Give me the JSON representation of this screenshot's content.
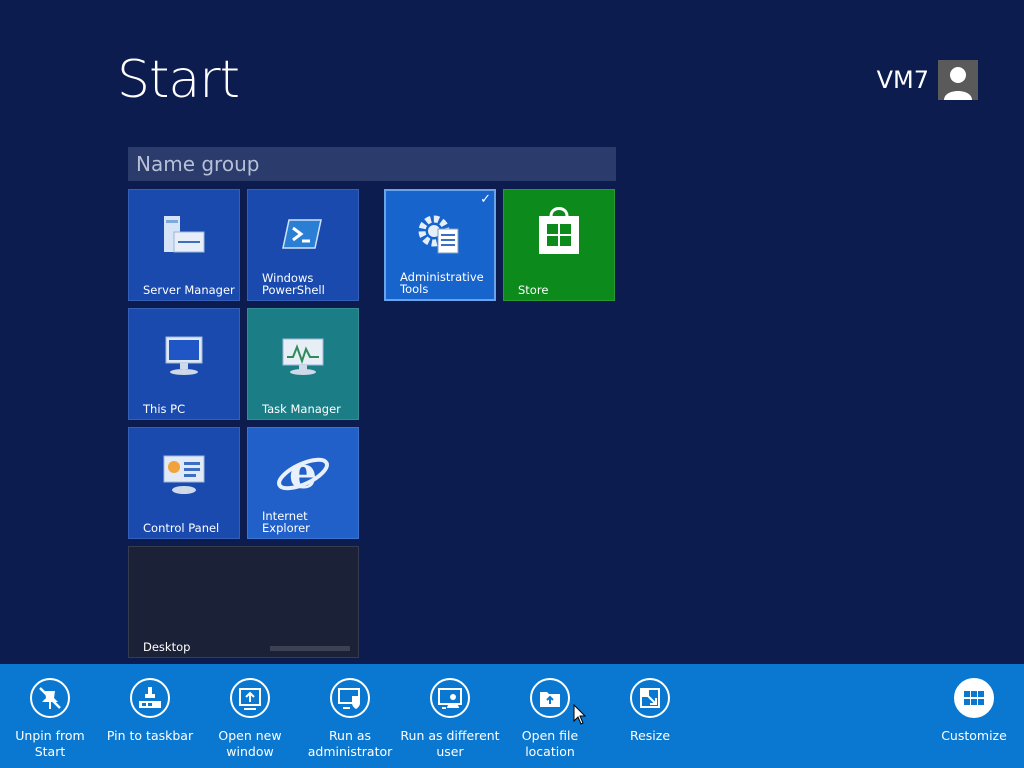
{
  "header": {
    "title": "Start",
    "user_name": "VM7",
    "avatar_icon": "user-silhouette-icon"
  },
  "group": {
    "placeholder": "Name group"
  },
  "tiles": [
    {
      "label": "Server Manager",
      "icon": "server-manager-icon"
    },
    {
      "label": "Windows\nPowerShell",
      "icon": "powershell-icon"
    },
    {
      "label": "This PC",
      "icon": "computer-icon"
    },
    {
      "label": "Task Manager",
      "icon": "task-manager-icon"
    },
    {
      "label": "Control Panel",
      "icon": "control-panel-icon"
    },
    {
      "label": "Internet Explorer",
      "icon": "internet-explorer-icon"
    },
    {
      "label": "Desktop",
      "icon": "desktop-icon"
    },
    {
      "label": "Administrative\nTools",
      "icon": "admin-tools-icon",
      "selected": true
    },
    {
      "label": "Store",
      "icon": "store-icon"
    }
  ],
  "app_bar": {
    "commands": [
      {
        "label": "Unpin from Start",
        "icon": "unpin-icon"
      },
      {
        "label": "Pin to taskbar",
        "icon": "pin-taskbar-icon"
      },
      {
        "label": "Open new\nwindow",
        "icon": "new-window-icon"
      },
      {
        "label": "Run as\nadministrator",
        "icon": "shield-icon"
      },
      {
        "label": "Run as different\nuser",
        "icon": "different-user-icon"
      },
      {
        "label": "Open file\nlocation",
        "icon": "folder-icon"
      },
      {
        "label": "Resize",
        "icon": "resize-icon"
      }
    ],
    "customize_label": "Customize",
    "customize_icon": "customize-icon"
  },
  "colors": {
    "background": "#0c1c4f",
    "app_bar": "#0a78d0",
    "store_tile": "#0d8a1c",
    "teal_tile": "#1b7d86"
  }
}
